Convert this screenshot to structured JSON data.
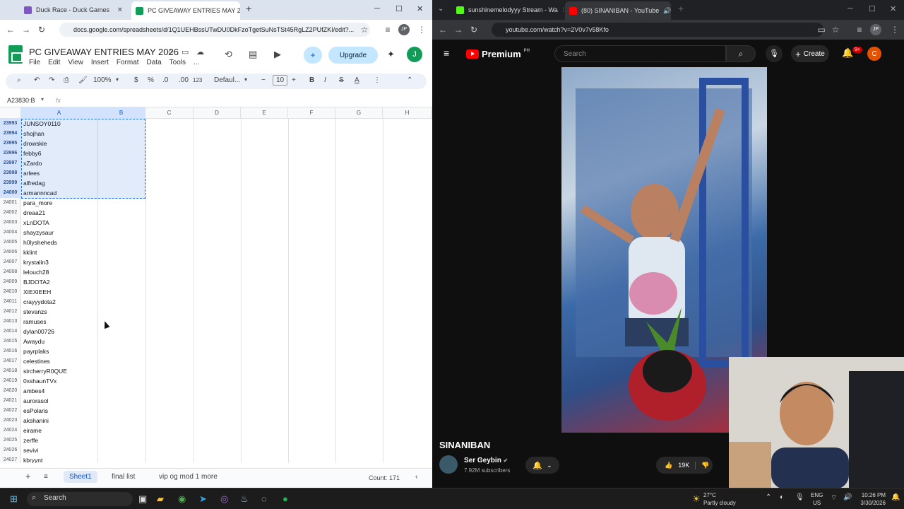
{
  "left_browser": {
    "tabs": [
      {
        "title": "Duck Race - Duck Games",
        "favicon_color": "#7e57c2"
      },
      {
        "title": "PC GIVEAWAY ENTRIES MAY 20",
        "favicon_color": "#0f9d58"
      }
    ],
    "new_tab": "+",
    "url": "docs.google.com/spreadsheets/d/1Q1UEHBssUTwDU0DkFzoTgetSuNsTSt45RgLZ2PUfZKI/edit?...",
    "avatar": "JP"
  },
  "sheet": {
    "title": "PC GIVEAWAY ENTRIES MAY 2026",
    "menu": [
      "File",
      "Edit",
      "View",
      "Insert",
      "Format",
      "Data",
      "Tools",
      "..."
    ],
    "upgrade_label": "Upgrade",
    "user_initial": "J",
    "toolbar": {
      "zoom": "100%",
      "currency": "$",
      "percent": "%",
      "dec_less": ".0",
      "dec_more": ".00",
      "numfmt": "123",
      "font": "Defaul...",
      "font_size": "10",
      "bold": "B",
      "italic": "I",
      "strike": "S",
      "color": "A"
    },
    "name_box": "A23830:B",
    "fx": "fx",
    "columns": [
      "A",
      "B",
      "C",
      "D",
      "E",
      "F",
      "G",
      "H"
    ],
    "rows": [
      {
        "n": "23993",
        "v": "JUNSOY0110"
      },
      {
        "n": "23994",
        "v": "shojhan"
      },
      {
        "n": "23995",
        "v": "drowskie"
      },
      {
        "n": "23996",
        "v": "febby6"
      },
      {
        "n": "23997",
        "v": "xZardo"
      },
      {
        "n": "23998",
        "v": "arlees"
      },
      {
        "n": "23999",
        "v": "alfredag"
      },
      {
        "n": "24000",
        "v": "armannncad"
      },
      {
        "n": "24001",
        "v": "para_more"
      },
      {
        "n": "24002",
        "v": "dreaa21"
      },
      {
        "n": "24003",
        "v": "xLnDOTA"
      },
      {
        "n": "24004",
        "v": "shayzysaur"
      },
      {
        "n": "24005",
        "v": "h0lysheheds"
      },
      {
        "n": "24006",
        "v": "kklint"
      },
      {
        "n": "24007",
        "v": "krystalin3"
      },
      {
        "n": "24008",
        "v": "lelouch28"
      },
      {
        "n": "24009",
        "v": "BJDOTA2"
      },
      {
        "n": "24010",
        "v": "XIEXIEEH"
      },
      {
        "n": "24011",
        "v": "crayyydota2"
      },
      {
        "n": "24012",
        "v": "stevanzs"
      },
      {
        "n": "24013",
        "v": "ramuses"
      },
      {
        "n": "24014",
        "v": "dylan00726"
      },
      {
        "n": "24015",
        "v": "Awaydu"
      },
      {
        "n": "24016",
        "v": "payrplaks"
      },
      {
        "n": "24017",
        "v": "celestines"
      },
      {
        "n": "24018",
        "v": "sircherryR0QUE"
      },
      {
        "n": "24019",
        "v": "0xshaunTVx"
      },
      {
        "n": "24020",
        "v": "ambes4"
      },
      {
        "n": "24021",
        "v": "aurorasol"
      },
      {
        "n": "24022",
        "v": "esPolaris"
      },
      {
        "n": "24023",
        "v": "akshanini"
      },
      {
        "n": "24024",
        "v": "eirame"
      },
      {
        "n": "24025",
        "v": "zerffe"
      },
      {
        "n": "24026",
        "v": "sevivi"
      },
      {
        "n": "24027",
        "v": "kbryynt"
      }
    ],
    "sheet_tabs": [
      "Sheet1",
      "final list",
      "vip og mod 1 more"
    ],
    "count": "Count: 171"
  },
  "right_browser": {
    "tabs": [
      {
        "title": "sunshinemelodyyy Stream - Wa",
        "favicon_color": "#53fc18"
      },
      {
        "title": "(80) SINANIBAN - YouTube",
        "favicon_color": "#ff0000"
      }
    ],
    "url": "youtube.com/watch?v=2V0v7v58Kfo",
    "avatar": "JP"
  },
  "youtube": {
    "brand": "Premium",
    "region": "PH",
    "search_placeholder": "Search",
    "create_label": "Create",
    "notif_count": "9+",
    "avatar_initial": "C",
    "video_title": "SINANIBAN",
    "channel": "Ser Geybin",
    "subscribers": "7.92M subscribers",
    "likes": "19K"
  },
  "taskbar": {
    "search": "Search",
    "weather_temp": "27°C",
    "weather_desc": "Partly cloudy",
    "lang": "ENG",
    "region": "US",
    "time": "10:26 PM",
    "date": "3/30/2026"
  }
}
